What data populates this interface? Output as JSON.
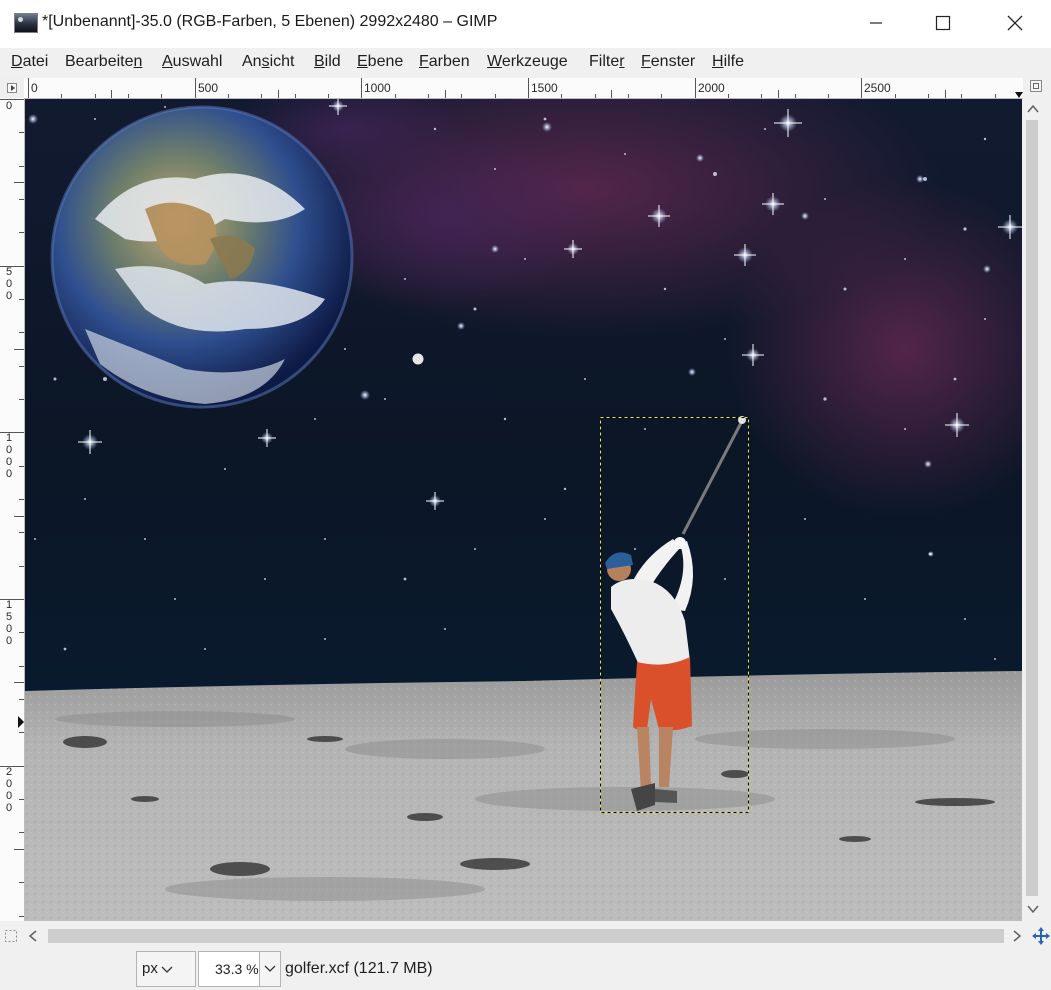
{
  "window": {
    "title": "*[Unbenannt]-35.0 (RGB-Farben, 5 Ebenen) 2992x2480 – GIMP"
  },
  "menu": {
    "items": [
      {
        "pre": "",
        "key": "D",
        "post": "atei"
      },
      {
        "pre": "Bearbeite",
        "key": "n",
        "post": ""
      },
      {
        "pre": "",
        "key": "A",
        "post": "uswahl"
      },
      {
        "pre": "An",
        "key": "s",
        "post": "icht"
      },
      {
        "pre": "",
        "key": "B",
        "post": "ild"
      },
      {
        "pre": "",
        "key": "E",
        "post": "bene"
      },
      {
        "pre": "",
        "key": "F",
        "post": "arben"
      },
      {
        "pre": "",
        "key": "W",
        "post": "erkzeuge"
      },
      {
        "pre": "Filte",
        "key": "r",
        "post": ""
      },
      {
        "pre": "",
        "key": "F",
        "post": "enster"
      },
      {
        "pre": "",
        "key": "H",
        "post": "ilfe"
      }
    ]
  },
  "rulers": {
    "horizontal": [
      "0",
      "500",
      "1000",
      "1500",
      "2000",
      "2500"
    ],
    "vertical": [
      "0",
      "500",
      "1000",
      "1500",
      "2000"
    ]
  },
  "statusbar": {
    "unit": "px",
    "zoom": "33.3 %",
    "file_info": "golfer.xcf (121.7 MB)"
  },
  "icons": {
    "app": "gimp-icon",
    "minimize": "minimize-icon",
    "maximize": "maximize-icon",
    "close": "close-icon",
    "navigate": "navigate-icon"
  }
}
